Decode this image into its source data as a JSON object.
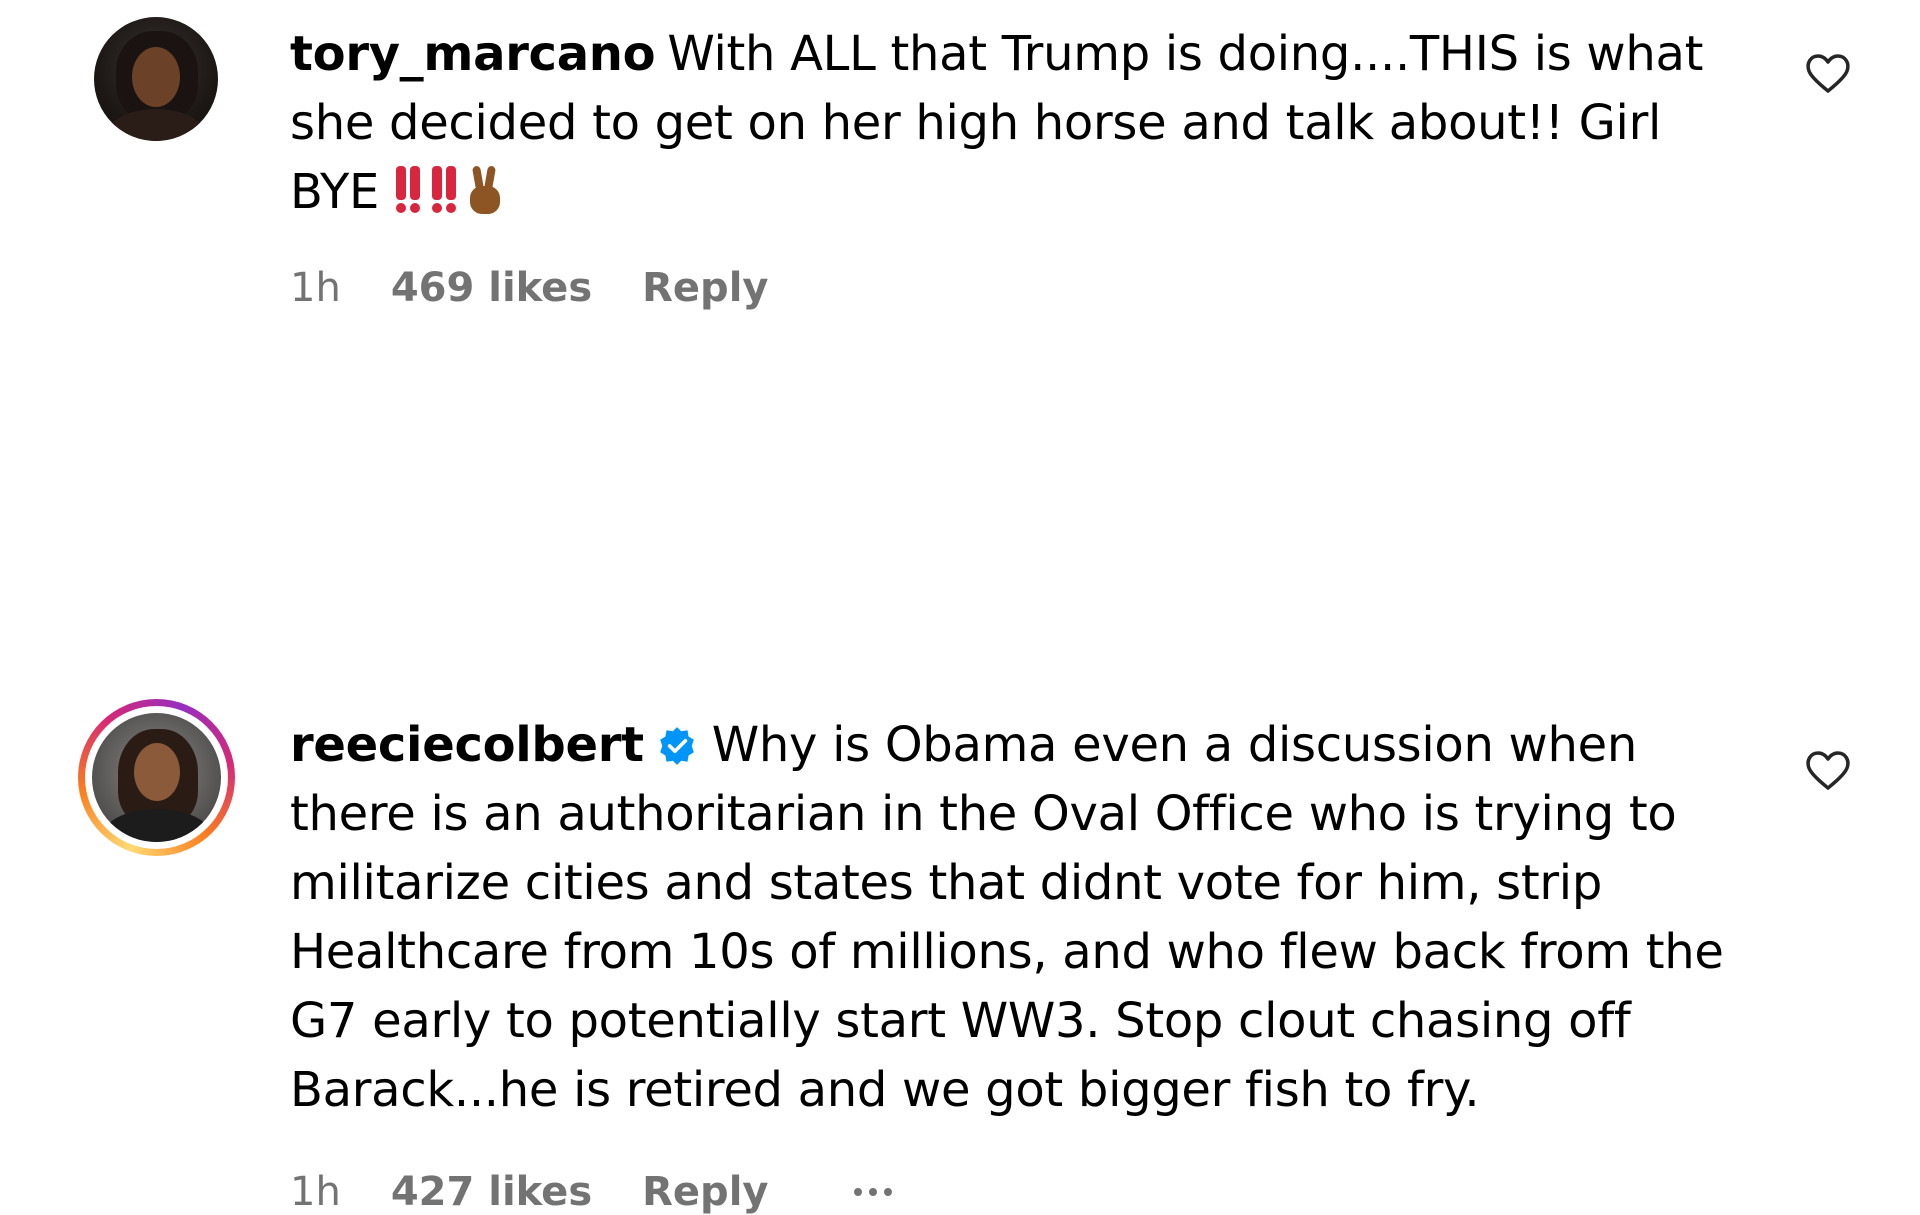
{
  "comments": [
    {
      "username": "tory_marcano",
      "verified": false,
      "text": "With ALL that Trump is doing....THIS is what she decided to get on her high horse and talk about!! Girl BYE",
      "emoji": "‼️‼️✌🏾",
      "time": "1h",
      "likes": "469 likes",
      "reply": "Reply"
    },
    {
      "username": "reeciecolbert",
      "verified": true,
      "text": "Why is Obama even a discussion when there is an authoritarian in the Oval Office who is trying to militarize cities and states that didnt vote for him, strip Healthcare from 10s of millions, and who flew back from the G7 early to potentially start WW3. Stop clout chasing off Barack...he is retired and we got bigger fish to fry.",
      "time": "1h",
      "likes": "427 likes",
      "reply": "Reply",
      "more_icon": "more-horizontal-icon"
    }
  ],
  "icons": {
    "like": "heart-outline-icon",
    "verified": "verified-badge-icon"
  },
  "colors": {
    "text": "#000000",
    "meta": "#737373",
    "verified_blue": "#0095f6",
    "story_ring": [
      "#feda75",
      "#fa7e1e",
      "#d62976",
      "#962fbf"
    ],
    "emoji_red": "#d7263d",
    "emoji_hand": "#8d5524"
  }
}
